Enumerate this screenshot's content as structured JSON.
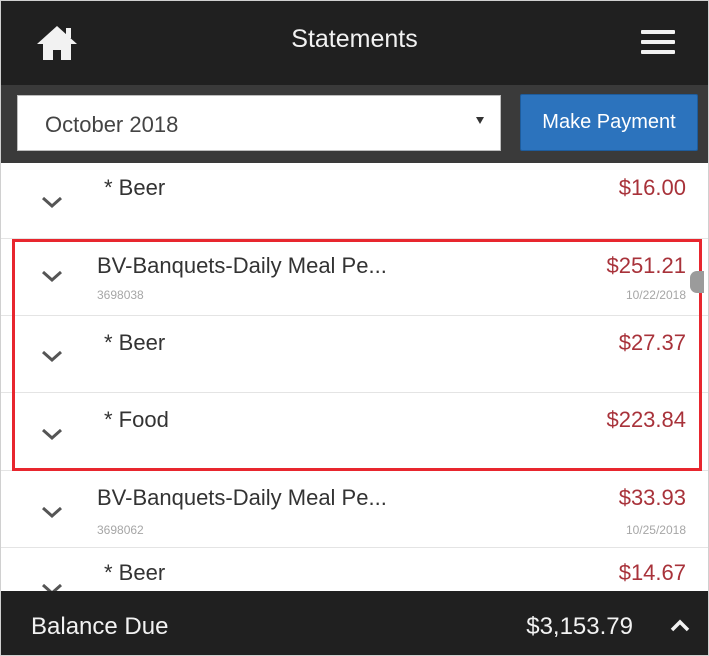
{
  "header": {
    "title": "Statements",
    "home_icon": "home-icon",
    "menu_icon": "hamburger-menu-icon"
  },
  "toolbar": {
    "month_selected": "October 2018",
    "make_payment_label": "Make Payment"
  },
  "rows": [
    {
      "desc": "* Beer",
      "amount": "$16.00",
      "sub": "",
      "date": ""
    },
    {
      "desc": "BV-Banquets-Daily Meal Pe...",
      "amount": "$251.21",
      "sub": "3698038",
      "date": "10/22/2018"
    },
    {
      "desc": "* Beer",
      "amount": "$27.37",
      "sub": "",
      "date": ""
    },
    {
      "desc": "* Food",
      "amount": "$223.84",
      "sub": "",
      "date": ""
    },
    {
      "desc": "BV-Banquets-Daily Meal Pe...",
      "amount": "$33.93",
      "sub": "3698062",
      "date": "10/25/2018"
    },
    {
      "desc": "* Beer",
      "amount": "$14.67",
      "sub": "",
      "date": ""
    }
  ],
  "footer": {
    "balance_label": "Balance Due",
    "balance_value": "$3,153.79"
  },
  "colors": {
    "header_bg": "#202020",
    "toolbar_bg": "#3a3a3a",
    "accent_blue": "#2c73bd",
    "amount_red": "#a8323a",
    "highlight_red": "#e8262e"
  }
}
